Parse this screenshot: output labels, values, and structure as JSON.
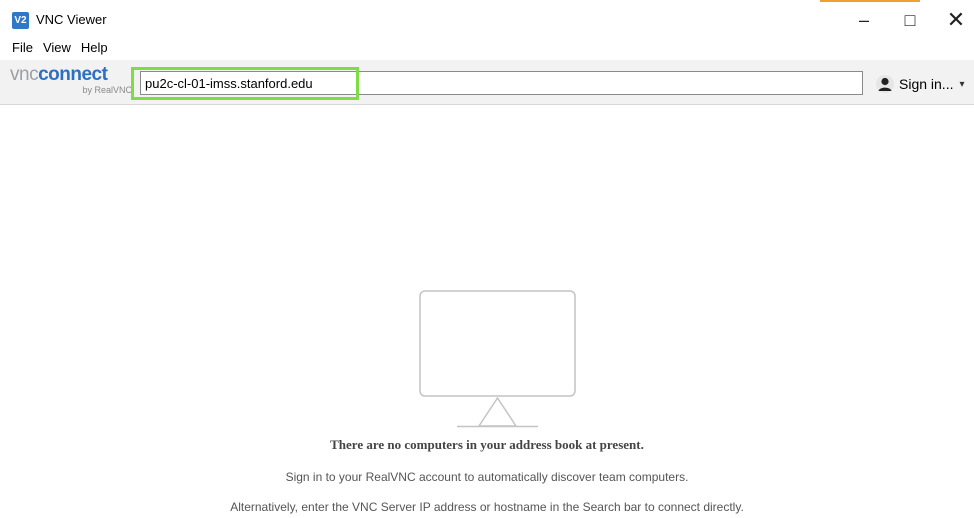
{
  "window": {
    "title": "VNC Viewer",
    "app_icon_text": "V2",
    "controls": {
      "minimize": "–",
      "maximize": "□",
      "close": "✕"
    }
  },
  "menu": {
    "items": [
      "File",
      "View",
      "Help"
    ]
  },
  "toolbar": {
    "logo_vnc": "vnc",
    "logo_connect": "connect",
    "logo_sub": "by RealVNC",
    "search_value": "pu2c-cl-01-imss.stanford.edu",
    "sign_in_label": "Sign in...",
    "sign_in_caret": "▾"
  },
  "main": {
    "empty_title": "There are no computers in your address book at present.",
    "empty_line1": "Sign in to your RealVNC account to automatically discover team computers.",
    "empty_line2": "Alternatively, enter the VNC Server IP address or hostname in the Search bar to connect directly."
  },
  "colors": {
    "highlight": "#7cde44",
    "brand_blue": "#2f6fbf"
  },
  "icons": {
    "app": "vnc-app-icon",
    "user": "user-avatar-icon",
    "empty_state": "monitor-icon"
  }
}
